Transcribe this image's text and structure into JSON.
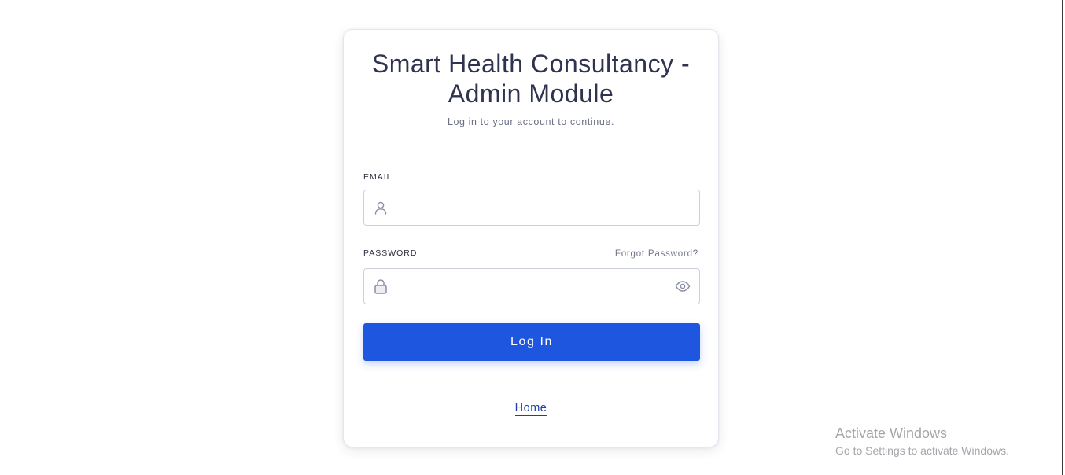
{
  "login": {
    "title_line1": "Smart Health Consultancy -",
    "title_line2": "Admin Module",
    "subtitle": "Log in to your account to continue.",
    "email_label": "EMAIL",
    "email_value": "",
    "password_label": "PASSWORD",
    "password_value": "",
    "forgot_password": "Forgot Password?",
    "login_button": "Log In",
    "home_link": "Home"
  },
  "icons": {
    "email": "user-icon",
    "password": "lock-icon",
    "toggle_visibility": "eye-icon"
  },
  "colors": {
    "primary": "#1f56e0",
    "link": "#1e3fa8",
    "text": "#2f3350",
    "muted": "#6b6f85",
    "border": "#ccd0dc"
  },
  "watermark": {
    "title": "Activate Windows",
    "subtitle": "Go to Settings to activate Windows."
  }
}
